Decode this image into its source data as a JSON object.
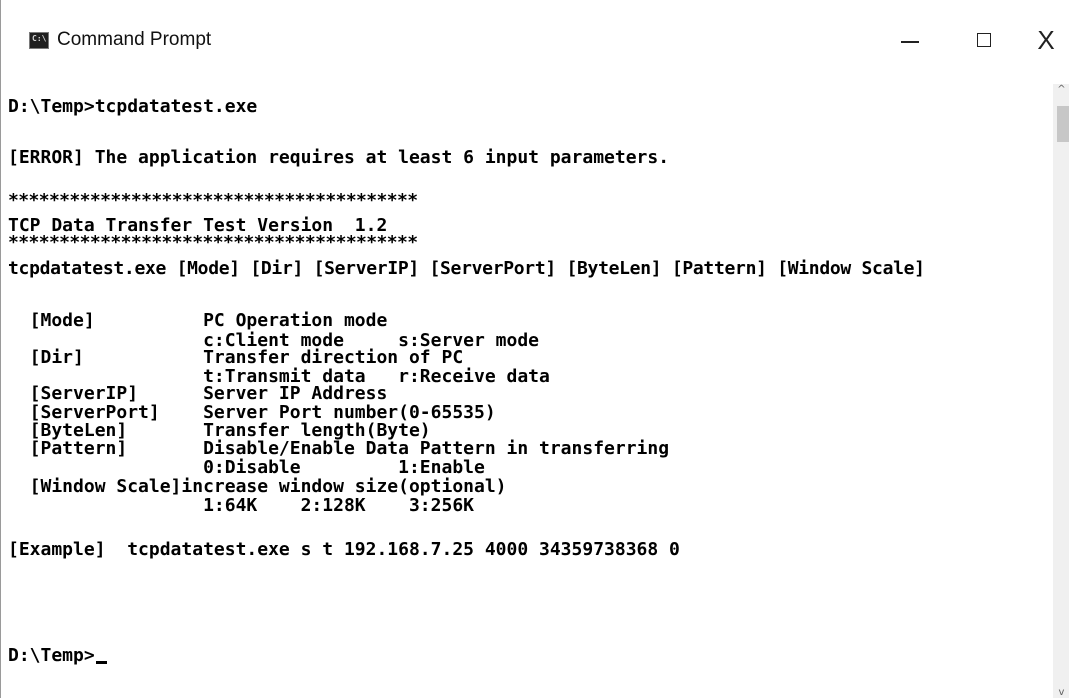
{
  "window": {
    "title": "Command Prompt",
    "icon_text": "C:\\",
    "icon": "console-app-icon",
    "controls": {
      "minimize_icon": "minimize-icon",
      "maximize_icon": "maximize-icon",
      "close_glyph": "X"
    }
  },
  "console": {
    "lines": [
      "D:\\Temp>tcpdatatest.exe",
      "",
      "[ERROR] The application requires at least 6 input parameters.",
      "",
      "****************************************",
      "TCP Data Transfer Test Version  1.2",
      "****************************************",
      "tcpdatatest.exe [Mode] [Dir] [ServerIP] [ServerPort] [ByteLen] [Pattern] [Window Scale]",
      "",
      "  [Mode]          PC Operation mode",
      "                  c:Client mode     s:Server mode",
      "  [Dir]           Transfer direction of PC",
      "                  t:Transmit data   r:Receive data",
      "  [ServerIP]      Server IP Address",
      "  [ServerPort]    Server Port number(0-65535)",
      "  [ByteLen]       Transfer length(Byte)",
      "  [Pattern]       Disable/Enable Data Pattern in transferring",
      "                  0:Disable         1:Enable",
      "  [Window Scale]increase window size(optional)",
      "                  1:64K    2:128K    3:256K",
      "",
      "[Example]  tcpdatatest.exe s t 192.168.7.25 4000 34359738368 0",
      "",
      "",
      "D:\\Temp>"
    ]
  },
  "scrollbar": {
    "up_arrow": "^",
    "down_arrow": "v"
  },
  "colors": {
    "background": "#ffffff",
    "text": "#000000"
  }
}
